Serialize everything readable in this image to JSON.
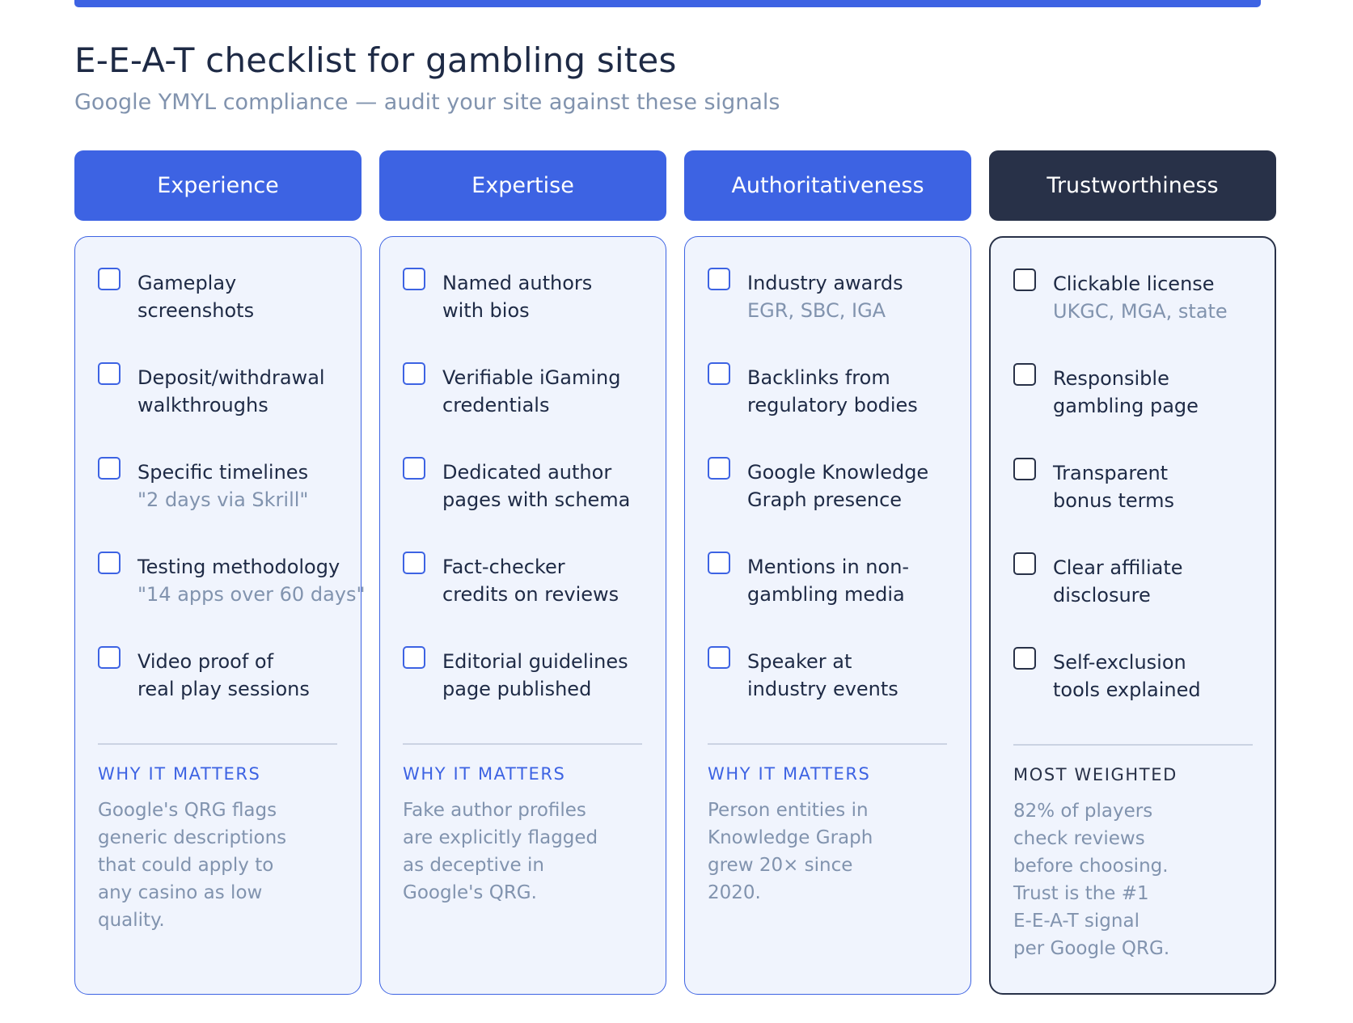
{
  "page": {
    "title": "E-E-A-T checklist for gambling sites",
    "subtitle": "Google YMYL compliance — audit your site against these signals"
  },
  "colors": {
    "accent": "#3d63e3",
    "dark": "#283148",
    "card_bg": "#f0f4fd",
    "muted_text": "#8193ae",
    "body_text": "#1e2a45"
  },
  "icons": {
    "checkbox": "checkbox-icon"
  },
  "columns": [
    {
      "header": "Experience",
      "items": [
        {
          "lines": [
            "Gameplay",
            "screenshots"
          ],
          "note": ""
        },
        {
          "lines": [
            "Deposit/withdrawal",
            "walkthroughs"
          ],
          "note": ""
        },
        {
          "lines": [
            "Specific timelines"
          ],
          "note": "\"2 days via Skrill\""
        },
        {
          "lines": [
            "Testing methodology"
          ],
          "note": "\"14 apps over 60 days\""
        },
        {
          "lines": [
            "Video proof of",
            "real play sessions"
          ],
          "note": ""
        }
      ],
      "note_title": "WHY IT MATTERS",
      "note_lines": [
        "Google's QRG flags",
        "generic descriptions",
        "that could apply to",
        "any casino as low",
        "quality."
      ]
    },
    {
      "header": "Expertise",
      "items": [
        {
          "lines": [
            "Named authors",
            "with bios"
          ],
          "note": ""
        },
        {
          "lines": [
            "Verifiable iGaming",
            "credentials"
          ],
          "note": ""
        },
        {
          "lines": [
            "Dedicated author",
            "pages with schema"
          ],
          "note": ""
        },
        {
          "lines": [
            "Fact-checker",
            "credits on reviews"
          ],
          "note": ""
        },
        {
          "lines": [
            "Editorial guidelines",
            "page published"
          ],
          "note": ""
        }
      ],
      "note_title": "WHY IT MATTERS",
      "note_lines": [
        "Fake author profiles",
        "are explicitly flagged",
        "as deceptive in",
        "Google's QRG."
      ]
    },
    {
      "header": "Authoritativeness",
      "items": [
        {
          "lines": [
            "Industry awards"
          ],
          "note": "EGR, SBC, IGA"
        },
        {
          "lines": [
            "Backlinks from",
            "regulatory bodies"
          ],
          "note": ""
        },
        {
          "lines": [
            "Google Knowledge",
            "Graph presence"
          ],
          "note": ""
        },
        {
          "lines": [
            "Mentions in non-",
            "gambling media"
          ],
          "note": ""
        },
        {
          "lines": [
            "Speaker at",
            "industry events"
          ],
          "note": ""
        }
      ],
      "note_title": "WHY IT MATTERS",
      "note_lines": [
        "Person entities in",
        "Knowledge Graph",
        "grew 20× since",
        "2020."
      ]
    },
    {
      "header": "Trustworthiness",
      "items": [
        {
          "lines": [
            "Clickable license"
          ],
          "note": "UKGC, MGA, state"
        },
        {
          "lines": [
            "Responsible",
            "gambling page"
          ],
          "note": ""
        },
        {
          "lines": [
            "Transparent",
            "bonus terms"
          ],
          "note": ""
        },
        {
          "lines": [
            "Clear affiliate",
            "disclosure"
          ],
          "note": ""
        },
        {
          "lines": [
            "Self-exclusion",
            "tools explained"
          ],
          "note": ""
        }
      ],
      "note_title": "MOST WEIGHTED",
      "note_lines": [
        "82% of players",
        "check reviews",
        "before choosing.",
        "Trust is the #1",
        "E-E-A-T signal",
        "per Google QRG."
      ]
    }
  ]
}
